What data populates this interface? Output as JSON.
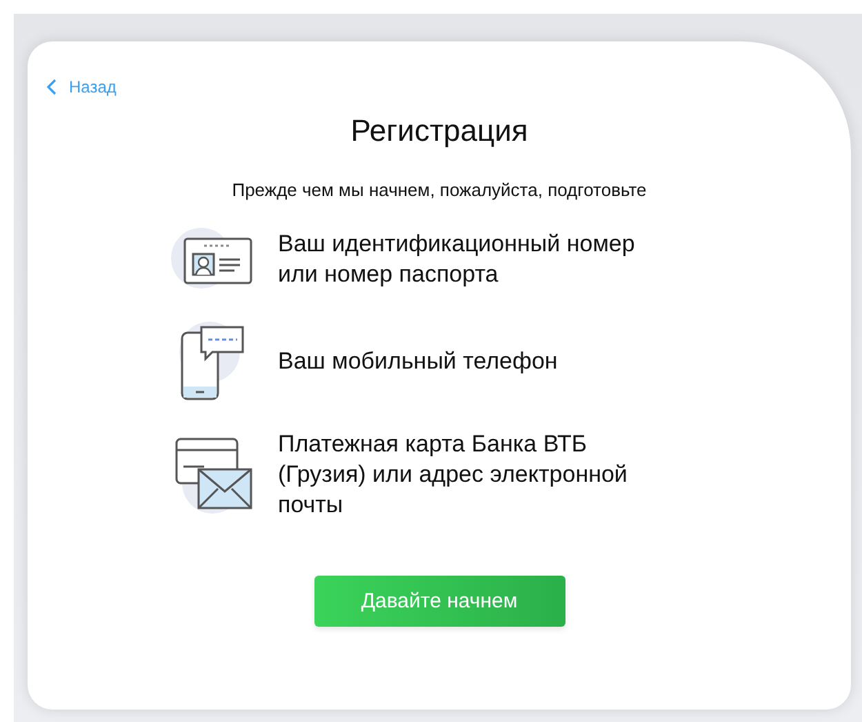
{
  "back_link": {
    "label": "Назад"
  },
  "title": "Регистрация",
  "subtitle": "Прежде чем мы начнем, пожалуйста, подготовьте",
  "items": [
    {
      "kind": "id",
      "text": "Ваш идентификационный номер или номер паспорта"
    },
    {
      "kind": "phone",
      "text": "Ваш мобильный телефон"
    },
    {
      "kind": "mail",
      "text": "Платежная карта Банка ВТБ (Грузия) или адрес электронной почты"
    }
  ],
  "start_button": {
    "label": "Давайте начнем"
  }
}
